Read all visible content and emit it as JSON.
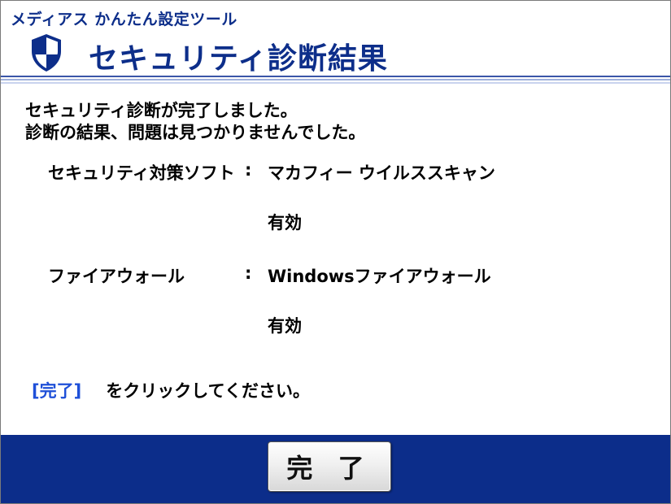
{
  "app": {
    "title": "メディアス かんたん設定ツール"
  },
  "header": {
    "title": "セキュリティ診断結果",
    "icon": "shield-icon"
  },
  "message": {
    "line1": "セキュリティ診断が完了しました。",
    "line2": "診断の結果、問題は見つかりませんでした。"
  },
  "results": [
    {
      "label": "セキュリティ対策ソフト",
      "colon": ":",
      "product": "マカフィー ウイルススキャン",
      "status": "有効"
    },
    {
      "label": "ファイアウォール",
      "colon": ":",
      "product": "Windowsファイアウォール",
      "status": "有効"
    }
  ],
  "instruction": {
    "link": "[完了]",
    "text": "をクリックしてください。"
  },
  "footer": {
    "done_label": "完 了"
  },
  "colors": {
    "brand": "#0d2e8a",
    "footer": "#0c2d8a",
    "link": "#1e4fd8"
  }
}
